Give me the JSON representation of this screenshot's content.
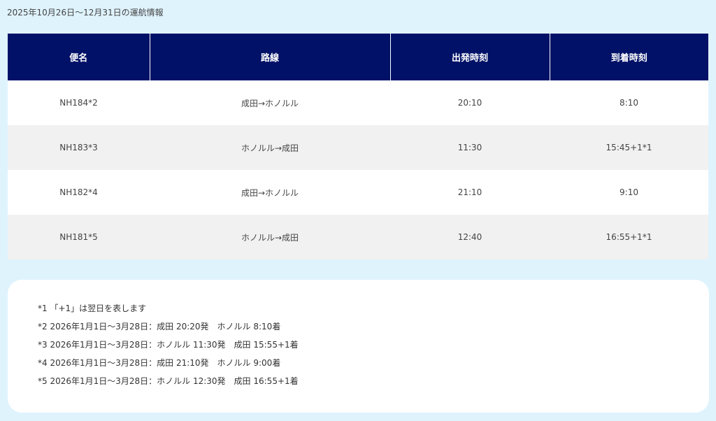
{
  "period_label": "2025年10月26日〜12月31日の運航情報",
  "table": {
    "headers": [
      "便名",
      "路線",
      "出発時刻",
      "到着時刻"
    ],
    "rows": [
      {
        "flight": "NH184*2",
        "route": "成田→ホノルル",
        "departure": "20:10",
        "arrival": "8:10"
      },
      {
        "flight": "NH183*3",
        "route": "ホノルル→成田",
        "departure": "11:30",
        "arrival": "15:45+1*1"
      },
      {
        "flight": "NH182*4",
        "route": "成田→ホノルル",
        "departure": "21:10",
        "arrival": "9:10"
      },
      {
        "flight": "NH181*5",
        "route": "ホノルル→成田",
        "departure": "12:40",
        "arrival": "16:55+1*1"
      }
    ]
  },
  "notes": [
    "*1 「+1」は翌日を表します",
    "*2 2026年1月1日〜3月28日：成田 20:20発　ホノルル 8:10着",
    "*3 2026年1月1日〜3月28日：ホノルル 11:30発　成田 15:55+1着",
    "*4 2026年1月1日〜3月28日：成田 21:10発　ホノルル 9:00着",
    "*5 2026年1月1日〜3月28日：ホノルル 12:30発　成田 16:55+1着"
  ],
  "colors": {
    "page_background": "#dff3fd",
    "header_background": "#001167",
    "row_alt": "#f1f1f1"
  }
}
